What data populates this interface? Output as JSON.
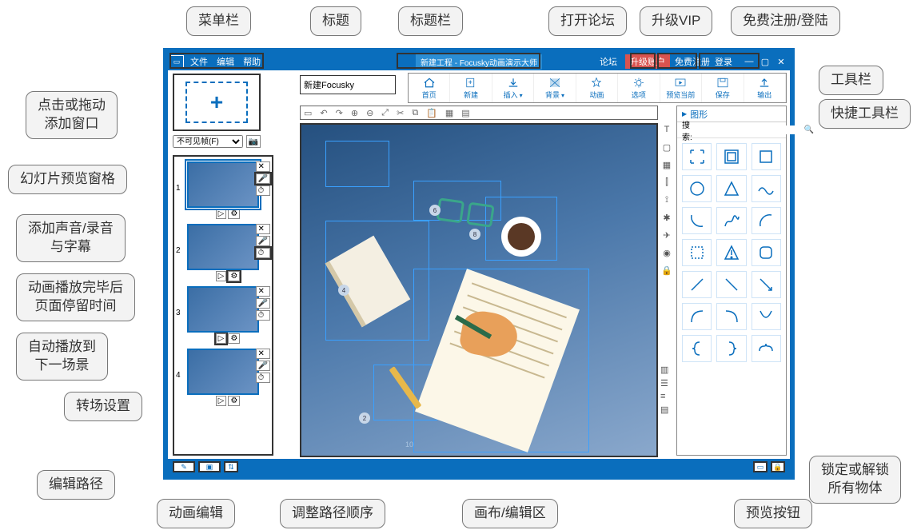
{
  "callouts": {
    "menubar": "菜单栏",
    "title": "标题",
    "titlebar": "标题栏",
    "forum": "打开论坛",
    "vip": "升级VIP",
    "login": "免费注册/登陆",
    "toolbar": "工具栏",
    "quickbar": "快捷工具栏",
    "addframe": "点击或拖动\n添加窗口",
    "slidepane": "幻灯片预览窗格",
    "audio": "添加声音/录音\n与字幕",
    "stay": "动画播放完毕后\n页面停留时间",
    "autoplay": "自动播放到\n下一场景",
    "transition": "转场设置",
    "editpath": "编辑路径",
    "animedit": "动画编辑",
    "reorder": "调整路径顺序",
    "canvas": "画布/编辑区",
    "preview": "预览按钮",
    "lock": "锁定或解锁\n所有物体"
  },
  "titlebar": {
    "menu": {
      "file": "文件",
      "edit": "编辑",
      "help": "帮助"
    },
    "center": "新建工程 - Focusky动画演示大师",
    "forum": "论坛",
    "upgrade": "升级账户",
    "register": "免费注册",
    "login": "登录",
    "min": "—",
    "max": "▢",
    "close": "✕"
  },
  "titlefield": "新建Focusky",
  "toolbar": [
    {
      "icon": "home",
      "label": "首页"
    },
    {
      "icon": "new",
      "label": "新建"
    },
    {
      "icon": "insert",
      "label": "插入",
      "caret": true
    },
    {
      "icon": "bg",
      "label": "背景",
      "caret": true
    },
    {
      "icon": "anim",
      "label": "动画"
    },
    {
      "icon": "options",
      "label": "选项"
    },
    {
      "icon": "preview",
      "label": "预览当前"
    },
    {
      "icon": "save",
      "label": "保存"
    },
    {
      "icon": "export",
      "label": "输出"
    }
  ],
  "framemode": {
    "label": "不可见帧(F)"
  },
  "panel": {
    "title": "图形",
    "search_label": "搜索:",
    "search_placeholder": ""
  },
  "slides": [
    1,
    2,
    3,
    4
  ],
  "canvas_nodes": [
    "2",
    "4",
    "6",
    "8",
    "10"
  ],
  "shape_names": [
    "rect-corners",
    "rect-frame",
    "square",
    "circle",
    "triangle",
    "wave",
    "arc-bl",
    "squiggle",
    "arc-tr",
    "dashed-rect",
    "warning-tri",
    "rounded",
    "line-diag1",
    "line-diag2",
    "line-diag3",
    "curve1",
    "curve2",
    "curve3",
    "brace-l",
    "brace-r",
    "brace-t"
  ]
}
